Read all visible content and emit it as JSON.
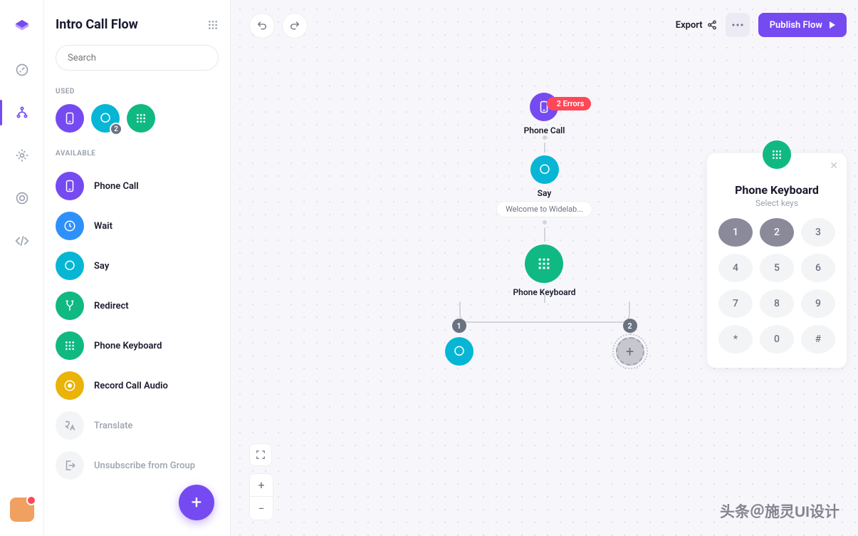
{
  "sidebar": {
    "title": "Intro Call Flow",
    "search_placeholder": "Search",
    "used_label": "USED",
    "available_label": "AVAILABLE",
    "used": [
      {
        "name": "phone-call",
        "color": "c-purple"
      },
      {
        "name": "say",
        "color": "c-cyan",
        "badge": "2"
      },
      {
        "name": "phone-keyboard",
        "color": "c-teal"
      }
    ],
    "available": [
      {
        "label": "Phone Call",
        "color": "c-purple",
        "icon": "phone"
      },
      {
        "label": "Wait",
        "color": "c-blue",
        "icon": "clock"
      },
      {
        "label": "Say",
        "color": "c-cyan",
        "icon": "chat"
      },
      {
        "label": "Redirect",
        "color": "c-teal",
        "icon": "split"
      },
      {
        "label": "Phone Keyboard",
        "color": "c-teal",
        "icon": "grid"
      },
      {
        "label": "Record Call Audio",
        "color": "c-yellow",
        "icon": "record"
      },
      {
        "label": "Translate",
        "disabled": true,
        "icon": "translate"
      },
      {
        "label": "Unsubscribe from Group",
        "disabled": true,
        "icon": "exit"
      }
    ]
  },
  "toolbar": {
    "export_label": "Export",
    "publish_label": "Publish Flow"
  },
  "flow": {
    "phone_call": {
      "label": "Phone Call",
      "errors": "2 Errors"
    },
    "say": {
      "label": "Say",
      "message": "Welcome to Widelab..."
    },
    "keyboard": {
      "label": "Phone Keyboard"
    },
    "branch1": "1",
    "branch2": "2"
  },
  "panel": {
    "title": "Phone Keyboard",
    "subtitle": "Select keys",
    "keys": [
      "1",
      "2",
      "3",
      "4",
      "5",
      "6",
      "7",
      "8",
      "9",
      "*",
      "0",
      "#"
    ],
    "selected": [
      "1",
      "2"
    ]
  },
  "watermark": "头条＠施灵UI设计"
}
